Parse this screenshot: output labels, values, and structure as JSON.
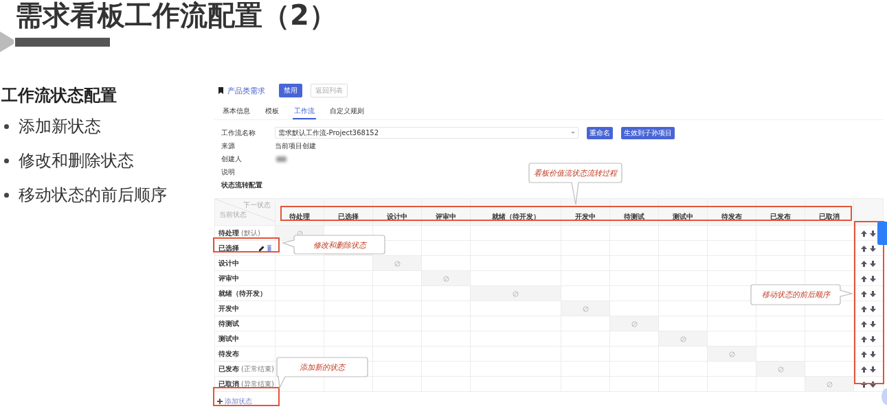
{
  "slide": {
    "title": "需求看板工作流配置（2）",
    "heading": "工作流状态配置",
    "bullets": [
      "添加新状态",
      "修改和删除状态",
      "移动状态的前后顺序"
    ]
  },
  "app": {
    "project": "产品类需求",
    "buttons": [
      {
        "label": "禁用",
        "kind": "primary"
      },
      {
        "label": "返回列表",
        "kind": "muted"
      }
    ],
    "tabs": [
      {
        "label": "基本信息",
        "selected": false
      },
      {
        "label": "模板",
        "selected": false
      },
      {
        "label": "工作流",
        "selected": true
      },
      {
        "label": "自定义规则",
        "selected": false
      }
    ],
    "form": [
      {
        "label": "工作流名称",
        "kind": "select",
        "value": "需求默认工作流-Project368152",
        "buttons": [
          "重命名",
          "生效到子孙项目"
        ]
      },
      {
        "label": "来源",
        "kind": "text",
        "value": "当前项目创建"
      },
      {
        "label": "创建人",
        "kind": "redacted"
      },
      {
        "label": "说明",
        "kind": "text"
      },
      {
        "label": "状态流转配置",
        "kind": "section"
      }
    ],
    "matrix": {
      "corner_next": "下一状态",
      "corner_current": "当前状态",
      "columns": [
        "待处理",
        "已选择",
        "设计中",
        "评审中",
        "就绪（待开发）",
        "开发中",
        "待测试",
        "测试中",
        "待发布",
        "已发布",
        "已取消"
      ],
      "rows": [
        {
          "name": "待处理",
          "note": "(默认)",
          "hovered": false
        },
        {
          "name": "已选择",
          "hovered": true
        },
        {
          "name": "设计中",
          "hovered": false
        },
        {
          "name": "评审中",
          "hovered": false
        },
        {
          "name": "就绪（待开发）",
          "hovered": false
        },
        {
          "name": "开发中",
          "hovered": false
        },
        {
          "name": "待测试",
          "hovered": false
        },
        {
          "name": "测试中",
          "hovered": false
        },
        {
          "name": "待发布",
          "hovered": false
        },
        {
          "name": "已发布",
          "note": "(正常结束)",
          "hovered": false
        },
        {
          "name": "已取消",
          "note": "(异常结束)",
          "hovered": false
        }
      ],
      "add_label": "添加状态"
    }
  },
  "callouts": [
    {
      "text": "看板价值流状态流转过程",
      "kind": "flow"
    },
    {
      "text": "修改和删除状态",
      "kind": "edit"
    },
    {
      "text": "移动状态的前后顺序",
      "kind": "order"
    },
    {
      "text": "添加新的状态",
      "kind": "add"
    }
  ]
}
